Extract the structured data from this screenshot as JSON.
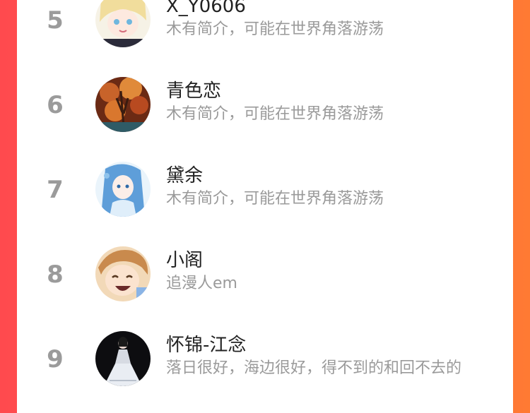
{
  "users": [
    {
      "rank": "5",
      "name": "X_Y0606",
      "bio": "木有简介，可能在世界角落游荡"
    },
    {
      "rank": "6",
      "name": "青色恋",
      "bio": "木有简介，可能在世界角落游荡"
    },
    {
      "rank": "7",
      "name": "黛余",
      "bio": "木有简介，可能在世界角落游荡"
    },
    {
      "rank": "8",
      "name": "小阁",
      "bio": "追漫人em"
    },
    {
      "rank": "9",
      "name": "怀锦-江念",
      "bio": "落日很好，海边很好，得不到的和回不去的"
    }
  ],
  "colors": {
    "background_left": "#ff4a4e",
    "background_right": "#ff7a33",
    "rank_text": "#9b9b9b",
    "name_text": "#222222",
    "bio_text": "#9a9a9a"
  }
}
